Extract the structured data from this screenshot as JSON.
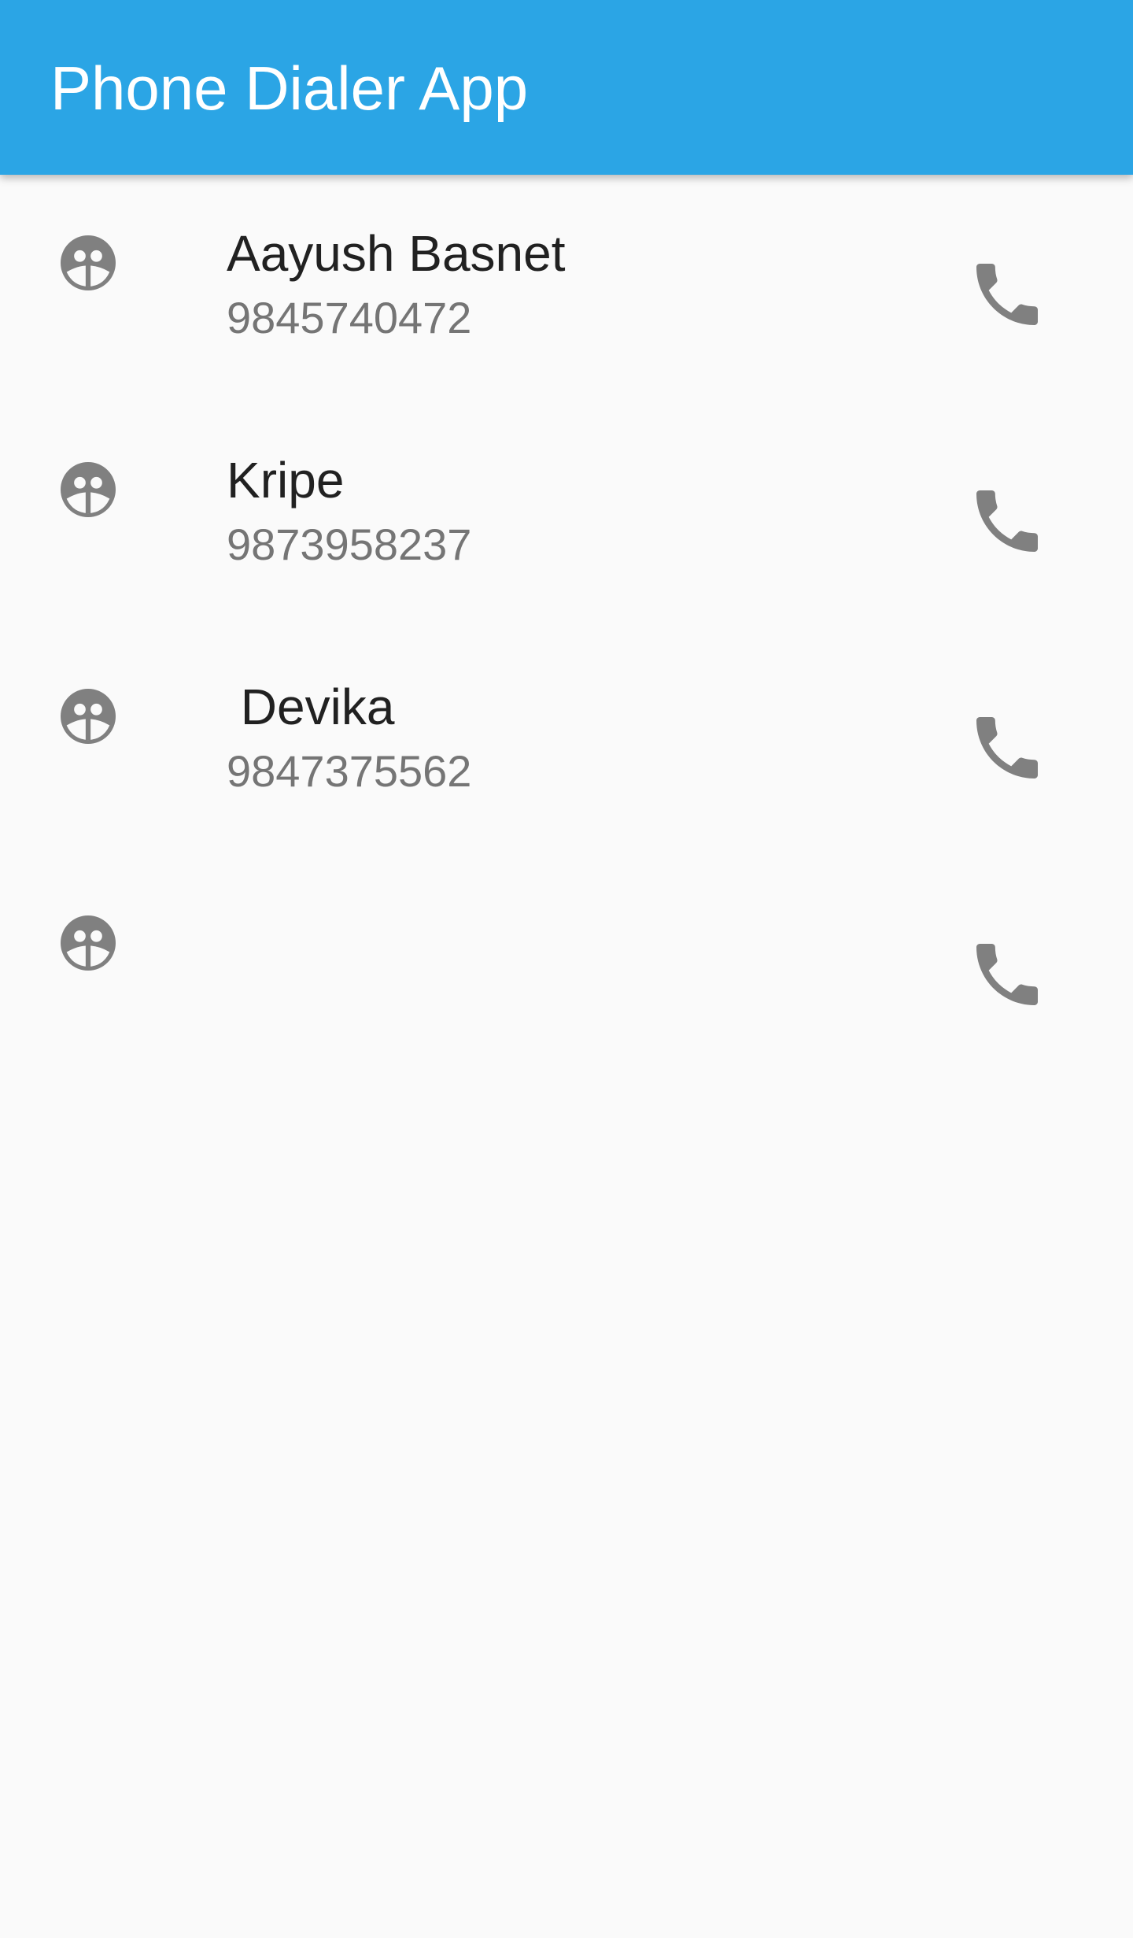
{
  "app_bar": {
    "title": "Phone Dialer App",
    "color": "#2ba5e5"
  },
  "contacts": [
    {
      "name": "Aayush Basnet",
      "number": "9845740472",
      "avatar_icon": "face-icon",
      "action_icon": "phone-icon"
    },
    {
      "name": "Kripe",
      "number": "9873958237",
      "avatar_icon": "face-icon",
      "action_icon": "phone-icon"
    },
    {
      "name": " Devika",
      "number": "9847375562",
      "avatar_icon": "face-icon",
      "action_icon": "phone-icon"
    },
    {
      "name": "",
      "number": "",
      "avatar_icon": "face-icon",
      "action_icon": "phone-icon"
    }
  ],
  "colors": {
    "background": "#fafafa",
    "icon": "#808080",
    "name_text": "#212121",
    "number_text": "#757575"
  }
}
